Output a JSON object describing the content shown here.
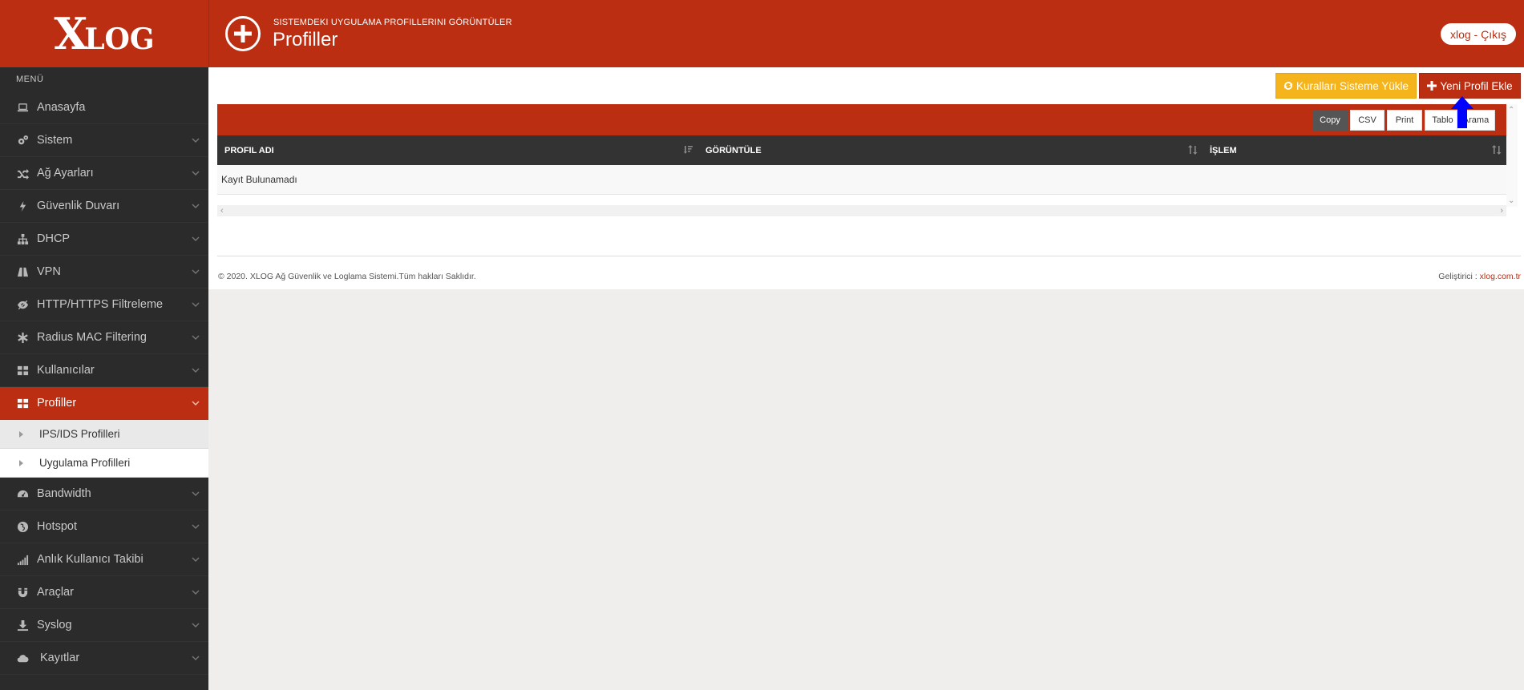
{
  "brand": {
    "logo_big": "X",
    "logo_small": "LOG"
  },
  "header": {
    "subtitle": "SISTEMDEKI UYGULAMA PROFILLERINI GÖRÜNTÜLER",
    "title": "Profiller",
    "user": "xlog - Çıkış"
  },
  "sidebar": {
    "menu_label": "MENÜ",
    "items": [
      {
        "label": "Anasayfa",
        "icon": "laptop-icon"
      },
      {
        "label": "Sistem",
        "icon": "cogs-icon"
      },
      {
        "label": "Ağ Ayarları",
        "icon": "random-icon"
      },
      {
        "label": "Güvenlik Duvarı",
        "icon": "bolt-icon"
      },
      {
        "label": "DHCP",
        "icon": "sitemap-icon"
      },
      {
        "label": "VPN",
        "icon": "road-icon"
      },
      {
        "label": "HTTP/HTTPS Filtreleme",
        "icon": "eye-slash-icon"
      },
      {
        "label": "Radius MAC Filtering",
        "icon": "asterisk-icon"
      },
      {
        "label": "Kullanıcılar",
        "icon": "th-large-icon"
      },
      {
        "label": "Profiller",
        "icon": "th-large-icon"
      },
      {
        "label": "Bandwidth",
        "icon": "dashboard-icon"
      },
      {
        "label": "Hotspot",
        "icon": "globe-icon"
      },
      {
        "label": "Anlık Kullanıcı Takibi",
        "icon": "signal-icon"
      },
      {
        "label": "Araçlar",
        "icon": "magnet-icon"
      },
      {
        "label": "Syslog",
        "icon": "download-icon"
      },
      {
        "label": "Kayıtlar",
        "icon": "cloud-icon"
      }
    ],
    "sub_items": [
      {
        "label": "IPS/IDS Profilleri"
      },
      {
        "label": "Uygulama Profilleri"
      }
    ]
  },
  "toolbar": {
    "sync_label": "Kuralları Sisteme Yükle",
    "new_label": "Yeni Profil Ekle"
  },
  "table": {
    "buttons": [
      "Copy",
      "CSV",
      "Print",
      "Tablo",
      "Arama"
    ],
    "columns": [
      "PROFIL ADI",
      "GÖRÜNTÜLE",
      "İŞLEM"
    ],
    "empty_text": "Kayıt Bulunamadı"
  },
  "footer": {
    "copyright": "© 2020. XLOG Ağ Güvenlik ve Loglama Sistemi.Tüm hakları Saklıdır.",
    "dev_label": "Geliştirici : ",
    "dev_link": "xlog.com.tr"
  },
  "colors": {
    "brand_red": "#bb2e12",
    "warning": "#f5b41b",
    "sidebar": "#2b2b2b",
    "arrow": "#0000ff"
  }
}
